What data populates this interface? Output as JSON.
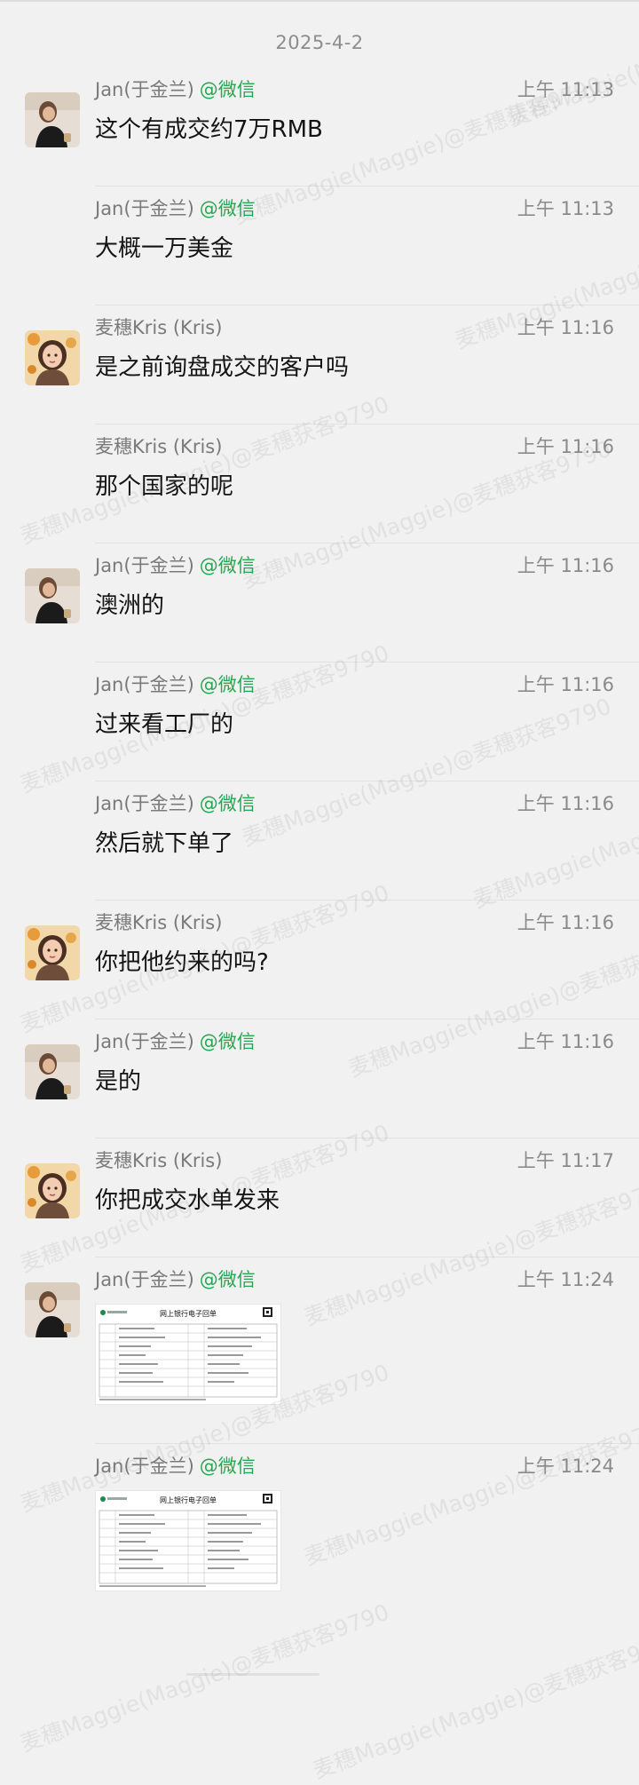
{
  "date_header": "2025-4-2",
  "messages": [
    {
      "sender": "Jan(于金兰)",
      "source": "@微信",
      "time": "上午 11:13",
      "text": "这个有成交约7万RMB",
      "avatar": "jan"
    },
    {
      "sender": "Jan(于金兰)",
      "source": "@微信",
      "time": "上午 11:13",
      "text": "大概一万美金",
      "avatar": ""
    },
    {
      "sender": "麦穗Kris (Kris)",
      "source": "",
      "time": "上午 11:16",
      "text": "是之前询盘成交的客户吗",
      "avatar": "kris"
    },
    {
      "sender": "麦穗Kris (Kris)",
      "source": "",
      "time": "上午 11:16",
      "text": "那个国家的呢",
      "avatar": ""
    },
    {
      "sender": "Jan(于金兰)",
      "source": "@微信",
      "time": "上午 11:16",
      "text": "澳洲的",
      "avatar": "jan"
    },
    {
      "sender": "Jan(于金兰)",
      "source": "@微信",
      "time": "上午 11:16",
      "text": "过来看工厂的",
      "avatar": ""
    },
    {
      "sender": "Jan(于金兰)",
      "source": "@微信",
      "time": "上午 11:16",
      "text": "然后就下单了",
      "avatar": ""
    },
    {
      "sender": "麦穗Kris (Kris)",
      "source": "",
      "time": "上午 11:16",
      "text": "你把他约来的吗?",
      "avatar": "kris"
    },
    {
      "sender": "Jan(于金兰)",
      "source": "@微信",
      "time": "上午 11:16",
      "text": "是的",
      "avatar": "jan"
    },
    {
      "sender": "麦穗Kris (Kris)",
      "source": "",
      "time": "上午 11:17",
      "text": "你把成交水单发来",
      "avatar": "kris"
    },
    {
      "sender": "Jan(于金兰)",
      "source": "@微信",
      "time": "上午 11:24",
      "image_title": "网上银行电子回单",
      "avatar": "jan"
    },
    {
      "sender": "Jan(于金兰)",
      "source": "@微信",
      "time": "上午 11:24",
      "image_title": "网上银行电子回单",
      "avatar": ""
    }
  ],
  "watermark": "麦穗Maggie(Maggie)@麦穗获客9790",
  "colors": {
    "source_green": "#23a94f",
    "background": "#f1f1f1"
  },
  "icons": {
    "jan_avatar": "woman-photo-avatar",
    "kris_avatar": "cartoon-woman-avatar"
  }
}
